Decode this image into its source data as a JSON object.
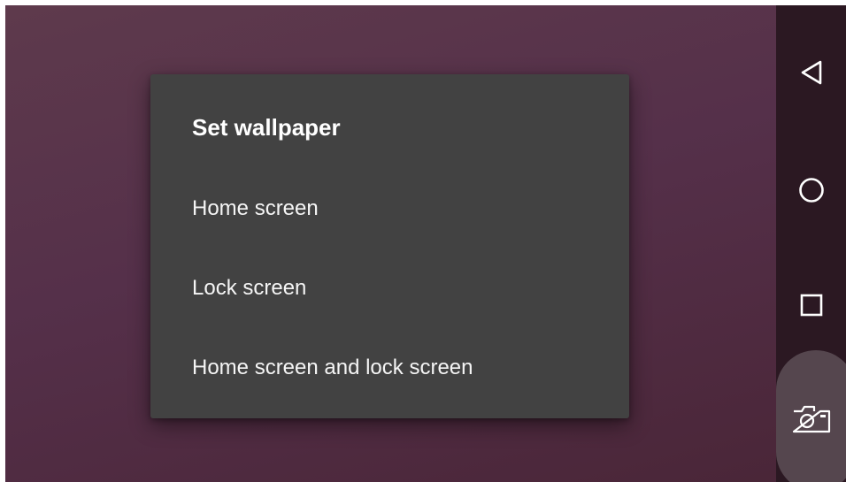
{
  "dialog": {
    "title": "Set wallpaper",
    "options": [
      {
        "label": "Home screen"
      },
      {
        "label": "Lock screen"
      },
      {
        "label": "Home screen and lock screen"
      }
    ]
  },
  "navbar": {
    "buttons": [
      {
        "icon": "back-triangle-icon"
      },
      {
        "icon": "home-circle-icon"
      },
      {
        "icon": "recents-square-icon"
      }
    ],
    "screenshot_icon": "camera-icon"
  },
  "colors": {
    "wallpaper": "#55304a",
    "dialog_background": "#424242",
    "navbar": "#2b1822",
    "text": "#ffffff"
  }
}
